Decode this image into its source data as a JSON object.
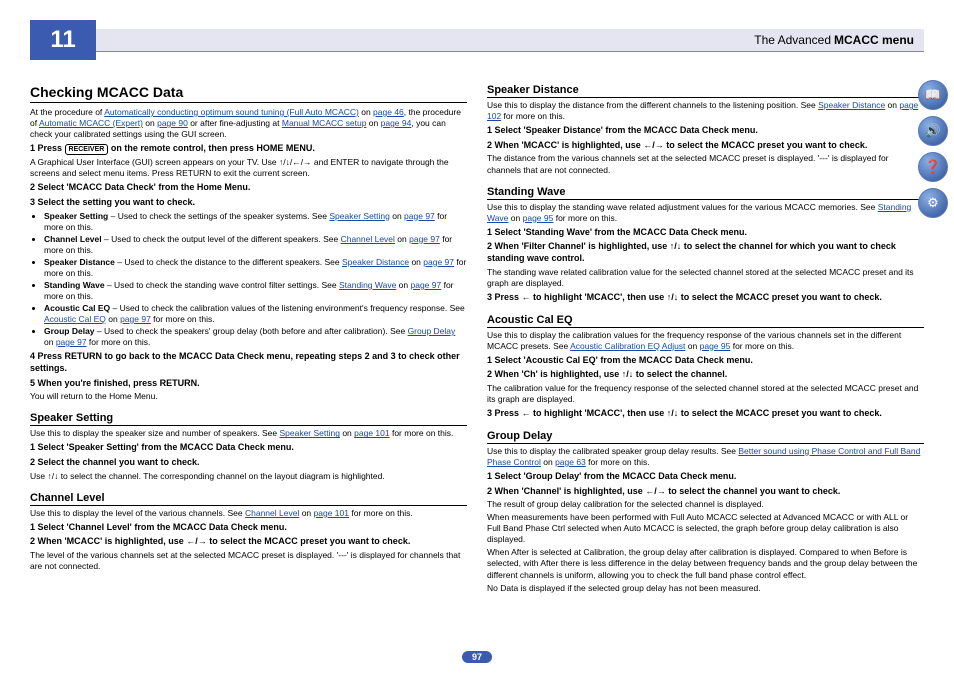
{
  "chapter": "11",
  "header_light": "The Advanced ",
  "header_bold": "MCACC menu",
  "page_num": "97",
  "left": {
    "h1": "Checking MCACC Data",
    "intro_a": "At the procedure of ",
    "intro_link1": "Automatically conducting optimum sound tuning (Full Auto MCACC)",
    "intro_b": " on ",
    "intro_link1p": "page 46",
    "intro_c": ", the procedure of ",
    "intro_link2": "Automatic MCACC (Expert)",
    "intro_d": " on ",
    "intro_link2p": "page 90",
    "intro_e": " or after fine-adjusting at ",
    "intro_link3": "Manual MCACC setup",
    "intro_f": " on ",
    "intro_link3p": "page 94",
    "intro_g": ", you can check your calibrated settings using the GUI screen.",
    "s1a": "1   Press ",
    "s1b": " on the remote control, then press HOME MENU.",
    "s1_sub": "A Graphical User Interface (GUI) screen appears on your TV. Use ↑/↓/←/→ and ENTER to navigate through the screens and select menu items. Press RETURN to exit the current screen.",
    "s2": "2   Select 'MCACC Data Check' from the Home Menu.",
    "s3": "3   Select the setting you want to check.",
    "b1a": "Speaker Setting",
    "b1b": " – Used to check the settings of the speaker systems. See ",
    "b1l": "Speaker Setting",
    "b1c": " on ",
    "b1p": "page 97",
    "b1d": " for more on this.",
    "b2a": "Channel Level",
    "b2b": " – Used to check the output level of the different speakers. See ",
    "b2l": "Channel Level",
    "b2c": " on ",
    "b2p": "page 97",
    "b2d": " for more on this.",
    "b3a": "Speaker Distance",
    "b3b": " – Used to check the distance to the different speakers. See ",
    "b3l": "Speaker Distance",
    "b3c": " on ",
    "b3p": "page 97",
    "b3d": " for more on this.",
    "b4a": "Standing Wave",
    "b4b": " – Used to check the standing wave control filter settings. See ",
    "b4l": "Standing Wave",
    "b4c": " on ",
    "b4p": "page 97",
    "b4d": " for more on this.",
    "b5a": "Acoustic Cal EQ",
    "b5b": " – Used to check the calibration values of the listening environment's frequency response. See ",
    "b5l": "Acoustic Cal EQ",
    "b5c": " on ",
    "b5p": "page 97",
    "b5d": " for more on this.",
    "b6a": "Group Delay",
    "b6b": " – Used to check the speakers' group delay (both before and after calibration). See ",
    "b6l": "Group Delay",
    "b6c": " on ",
    "b6p": "page 97",
    "b6d": " for more on this.",
    "s4": "4   Press RETURN to go back to the MCACC Data Check menu, repeating steps 2 and 3 to check other settings.",
    "s5": "5   When you're finished, press RETURN.",
    "s5_sub": "You will return to the Home Menu.",
    "ss_h": "Speaker Setting",
    "ss_p": "Use this to display the speaker size and number of speakers. See ",
    "ss_l": "Speaker Setting",
    "ss_p2": " on ",
    "ss_lp": "page 101",
    "ss_p3": " for more on this.",
    "ss_1": "1   Select 'Speaker Setting' from the MCACC Data Check menu.",
    "ss_2": "2   Select the channel you want to check.",
    "ss_2s": "Use ↑/↓ to select the channel. The corresponding channel on the layout diagram is highlighted.",
    "cl_h": "Channel Level",
    "cl_p": "Use this to display the level of the various channels. See ",
    "cl_l": "Channel Level",
    "cl_p2": " on ",
    "cl_lp": "page 101",
    "cl_p3": " for more on this.",
    "cl_1": "1   Select 'Channel Level' from the MCACC Data Check menu.",
    "cl_2": "2   When 'MCACC' is highlighted, use ←/→ to select the MCACC preset you want to check.",
    "cl_2s": "The level of the various channels set at the selected MCACC preset is displayed. '---' is displayed for channels that are not connected."
  },
  "right": {
    "sd_h": "Speaker Distance",
    "sd_p": "Use this to display the distance from the different channels to the listening position. See ",
    "sd_l": "Speaker Distance",
    "sd_p2": " on ",
    "sd_lp": "page 102",
    "sd_p3": " for more on this.",
    "sd_1": "1   Select 'Speaker Distance' from the MCACC Data Check menu.",
    "sd_2": "2   When 'MCACC' is highlighted, use ←/→ to select the MCACC preset you want to check.",
    "sd_2s": "The distance from the various channels set at the selected MCACC preset is displayed. '---' is displayed for channels that are not connected.",
    "sw_h": "Standing Wave",
    "sw_p": "Use this to display the standing wave related adjustment values for the various MCACC memories. See ",
    "sw_l": "Standing Wave",
    "sw_p2": " on ",
    "sw_lp": "page 95",
    "sw_p3": " for more on this.",
    "sw_1": "1   Select 'Standing Wave' from the MCACC Data Check menu.",
    "sw_2": "2   When 'Filter Channel' is highlighted, use ↑/↓ to select the channel for which you want to check standing wave control.",
    "sw_2s": "The standing wave related calibration value for the selected channel stored at the selected MCACC preset and its graph are displayed.",
    "sw_3": "3   Press ← to highlight 'MCACC', then use ↑/↓ to select the MCACC preset you want to check.",
    "ac_h": "Acoustic Cal EQ",
    "ac_p": "Use this to display the calibration values for the frequency response of the various channels set in the different MCACC presets. See ",
    "ac_l": "Acoustic Calibration EQ Adjust",
    "ac_p2": " on ",
    "ac_lp": "page 95",
    "ac_p3": " for more on this.",
    "ac_1": "1   Select 'Acoustic Cal EQ' from the MCACC Data Check menu.",
    "ac_2": "2   When 'Ch' is highlighted, use ↑/↓ to select the channel.",
    "ac_2s": "The calibration value for the frequency response of the selected channel stored at the selected MCACC preset and its graph are displayed.",
    "ac_3": "3   Press ← to highlight 'MCACC', then use ↑/↓ to select the MCACC preset you want to check.",
    "gd_h": "Group Delay",
    "gd_p": "Use this to display the calibrated speaker group delay results. See ",
    "gd_l": "Better sound using Phase Control and Full Band Phase Control",
    "gd_p2": " on ",
    "gd_lp": "page 63",
    "gd_p3": " for more on this.",
    "gd_1": "1   Select 'Group Delay' from the MCACC Data Check menu.",
    "gd_2": "2   When 'Channel' is highlighted, use ←/→ to select the channel you want to check.",
    "gd_2s": "The result of group delay calibration for the selected channel is displayed.",
    "gd_3": "When measurements have been performed with Full Auto MCACC selected at Advanced MCACC or with ALL or Full Band Phase Ctrl selected when Auto MCACC is selected, the graph before group delay calibration is also displayed.",
    "gd_4": "When After is selected at Calibration, the group delay after calibration is displayed. Compared to when Before is selected, with After there is less difference in the delay between frequency bands and the group delay between the different channels is uniform, allowing you to check the full band phase control effect.",
    "gd_5": "No Data is displayed if the selected group delay has not been measured."
  },
  "receiver_label": "RECEIVER"
}
